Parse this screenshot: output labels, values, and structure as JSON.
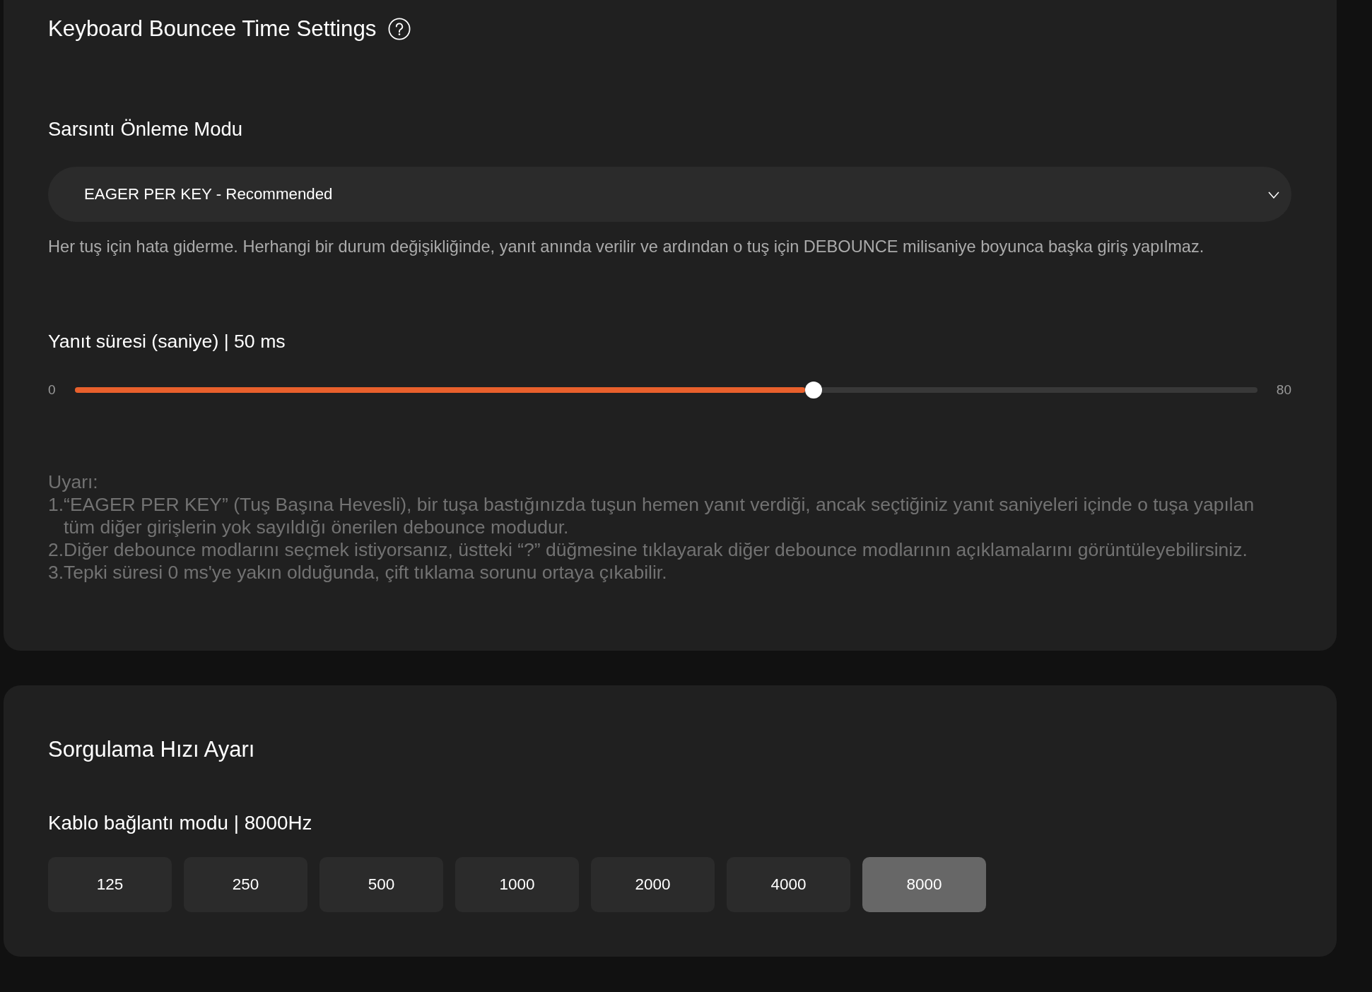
{
  "debounce_settings": {
    "title": "Keyboard Bouncee Time Settings",
    "mode": {
      "label": "Sarsıntı Önleme Modu",
      "value": "EAGER PER KEY - Recommended",
      "description": "Her tuş için hata giderme. Herhangi bir durum değişikliğinde, yanıt anında verilir ve ardından o tuş için DEBOUNCE milisaniye boyunca başka giriş yapılmaz."
    },
    "response_time": {
      "label": "Yanıt süresi (saniye) | 50 ms",
      "min_label": "0",
      "max_label": "80",
      "level": 0.625
    },
    "warning": {
      "title": "Uyarı:",
      "items": [
        "1.“EAGER PER KEY” (Tuş Başına Hevesli), bir tuşa bastığınızda tuşun hemen yanıt verdiği, ancak seçtiğiniz yanıt saniyeleri içinde o tuşa yapılan tüm diğer girişlerin yok sayıldığı önerilen debounce modudur.",
        "2.Diğer debounce modlarını seçmek istiyorsanız, üstteki “?” düğmesine tıklayarak diğer debounce modlarının açıklamalarını görüntüleyebilirsiniz.",
        "3.Tepki süresi 0 ms'ye yakın olduğunda, çift tıklama sorunu ortaya çıkabilir."
      ]
    }
  },
  "polling_rate": {
    "title": "Sorgulama Hızı Ayarı",
    "label": "Kablo bağlantı modu | 8000Hz",
    "options": [
      {
        "label": "125",
        "selected": false
      },
      {
        "label": "250",
        "selected": false
      },
      {
        "label": "500",
        "selected": false
      },
      {
        "label": "1000",
        "selected": false
      },
      {
        "label": "2000",
        "selected": false
      },
      {
        "label": "4000",
        "selected": false
      },
      {
        "label": "8000",
        "selected": true
      }
    ]
  }
}
